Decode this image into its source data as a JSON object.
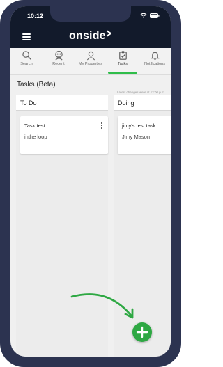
{
  "status_bar": {
    "time": "10:12"
  },
  "header": {
    "brand": "onside"
  },
  "tabs": [
    {
      "label": "Search",
      "icon": "search-icon"
    },
    {
      "label": "Recent",
      "icon": "recent-icon"
    },
    {
      "label": "My Properties",
      "icon": "properties-icon"
    },
    {
      "label": "Tasks",
      "icon": "tasks-icon",
      "active": true
    },
    {
      "label": "Notifications",
      "icon": "bell-icon"
    }
  ],
  "page": {
    "title": "Tasks (Beta)",
    "last_change": "Latest changes were at 12:00 p.m."
  },
  "columns": [
    {
      "title": "To Do",
      "cards": [
        {
          "title": "Task test",
          "assignee": "inthe loop"
        }
      ]
    },
    {
      "title": "Doing",
      "cards": [
        {
          "title": "jimy's test task",
          "assignee": "Jimy Mason"
        }
      ]
    }
  ],
  "colors": {
    "accent": "#2fbd4a",
    "fab": "#2ea843",
    "header_bg": "#121a2b",
    "phone_frame": "#2c3350"
  }
}
